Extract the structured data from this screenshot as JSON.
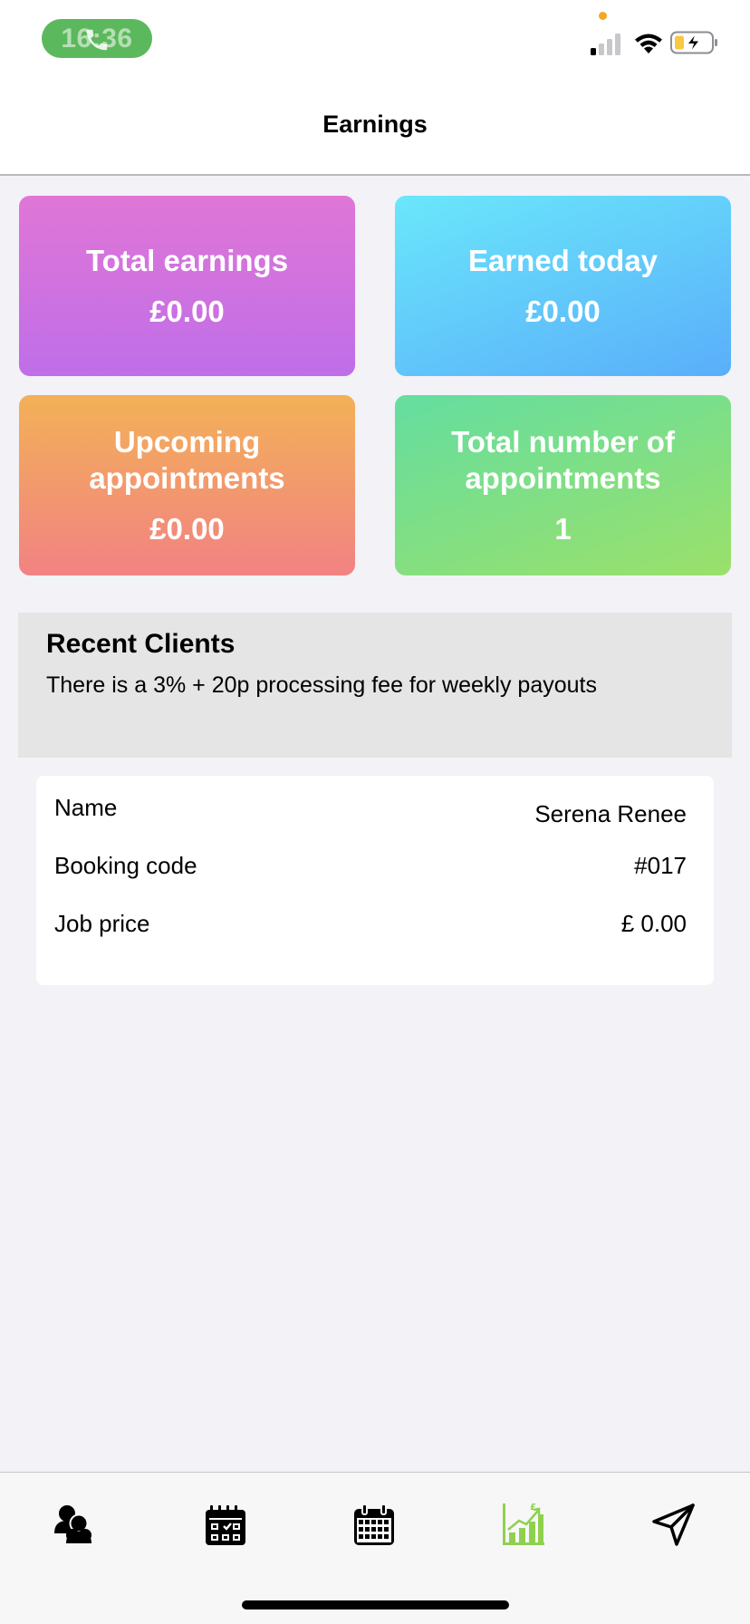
{
  "status_bar": {
    "time": "16:36",
    "call_icon": "phone-icon",
    "mic_dot_color": "#f5a623",
    "icons": [
      "cellular-signal-icon",
      "wifi-icon",
      "battery-charging-icon"
    ]
  },
  "nav": {
    "title": "Earnings"
  },
  "stats": {
    "total_earnings": {
      "label": "Total earnings",
      "value": "£0.00"
    },
    "earned_today": {
      "label": "Earned today",
      "value": "£0.00"
    },
    "upcoming": {
      "label": "Upcoming appointments",
      "value": "£0.00"
    },
    "total_appointments": {
      "label": "Total number of appointments",
      "value": "1"
    }
  },
  "recent": {
    "title": "Recent Clients",
    "note": "There is a 3% + 20p processing fee for weekly payouts"
  },
  "client": {
    "name_label": "Name",
    "name_value": "Serena Renee",
    "code_label": "Booking code",
    "code_value": "#017",
    "price_label": "Job price",
    "price_value": "£ 0.00"
  },
  "tabs": [
    {
      "icon": "clients-icon",
      "active": false
    },
    {
      "icon": "schedule-calendar-icon",
      "active": false
    },
    {
      "icon": "calendar-grid-icon",
      "active": false
    },
    {
      "icon": "earnings-chart-icon",
      "active": true
    },
    {
      "icon": "send-icon",
      "active": false
    }
  ],
  "colors": {
    "active_tab": "#8fd14f",
    "inactive_tab": "#000000",
    "page_background": "#f2f2f7"
  }
}
